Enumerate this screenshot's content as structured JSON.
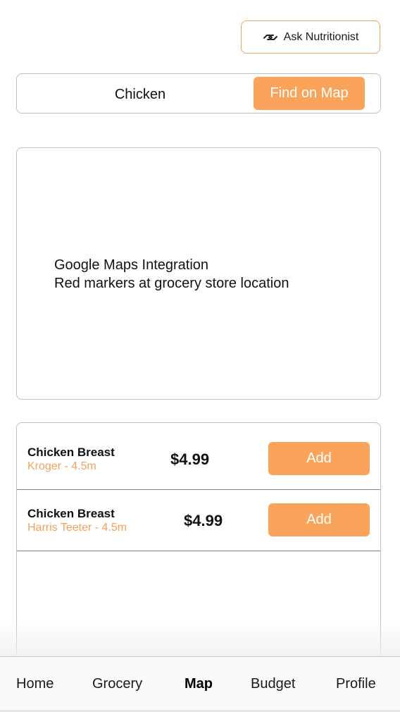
{
  "header": {
    "ask_button_label": "Ask Nutritionist",
    "ask_button_icon": "handshake-icon"
  },
  "search": {
    "value": "Chicken",
    "placeholder": "",
    "find_button_label": "Find on Map"
  },
  "map": {
    "line1": "Google Maps Integration",
    "line2": "Red markers at grocery store location"
  },
  "results": [
    {
      "name": "Chicken Breast",
      "store": "Kroger - 4.5m",
      "price": "$4.99",
      "add_label": "Add"
    },
    {
      "name": "Chicken Breast",
      "store": "Harris Teeter - 4.5m",
      "price": "$4.99",
      "add_label": "Add"
    }
  ],
  "nav": {
    "items": [
      {
        "label": "Home"
      },
      {
        "label": "Grocery"
      },
      {
        "label": "Map"
      },
      {
        "label": "Budget"
      },
      {
        "label": "Profile"
      }
    ],
    "active": "Map"
  },
  "colors": {
    "accent": "#f9a45a",
    "store_text": "#f4a25b",
    "border": "#bfbfbf"
  }
}
